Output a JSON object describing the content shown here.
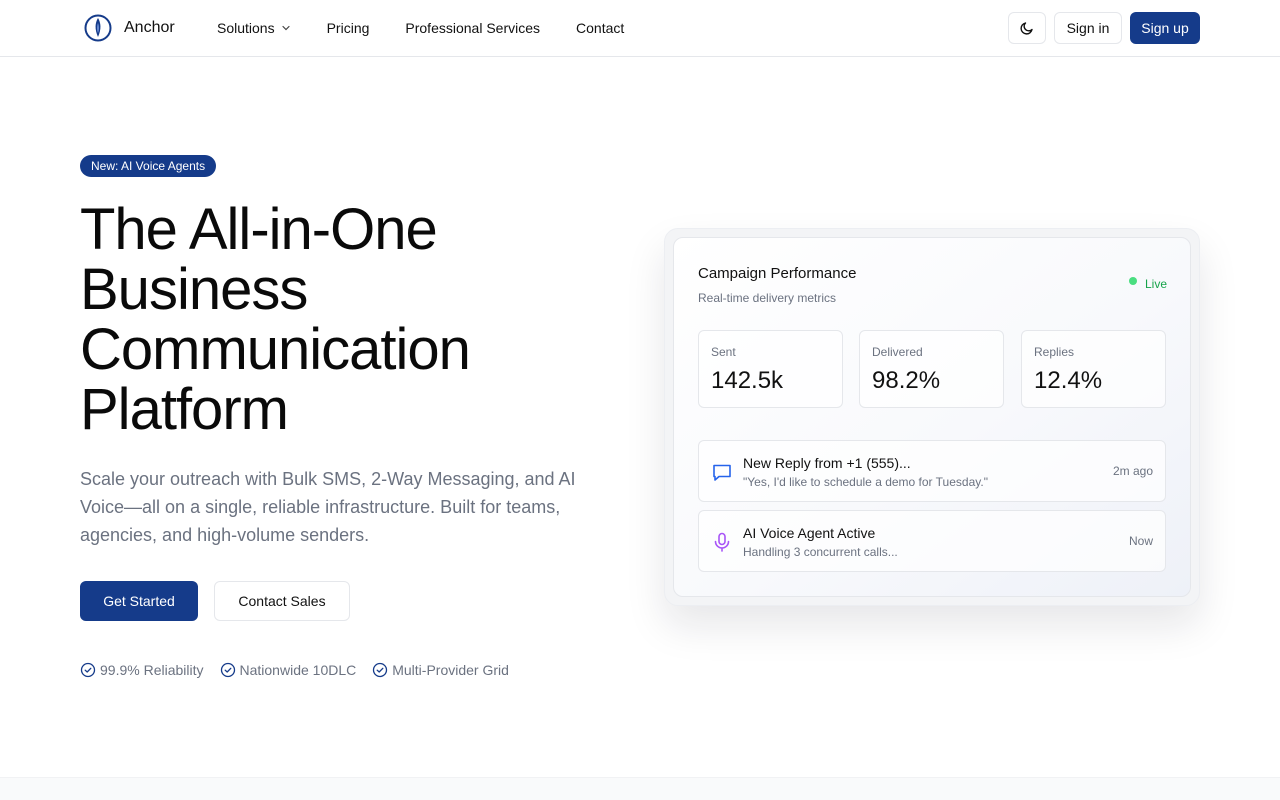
{
  "header": {
    "brand": "Anchor",
    "nav": [
      {
        "label": "Solutions",
        "has_dropdown": true,
        "icon": "chevron-down-icon"
      },
      {
        "label": "Pricing"
      },
      {
        "label": "Professional Services"
      },
      {
        "label": "Contact"
      }
    ],
    "theme_toggle_icon": "moon-icon",
    "sign_in_label": "Sign in",
    "sign_up_label": "Sign up"
  },
  "hero": {
    "badge": "New: AI Voice Agents",
    "title_lines": [
      "The All-in-One",
      "Business",
      "Communication",
      "Platform"
    ],
    "subtitle": "Scale your outreach with Bulk SMS, 2-Way Messaging, and AI Voice—all on a single, reliable infrastructure. Built for teams, agencies, and high-volume senders.",
    "primary_cta": "Get Started",
    "secondary_cta": "Contact Sales",
    "features": [
      "99.9% Reliability",
      "Nationwide 10DLC",
      "Multi-Provider Grid"
    ]
  },
  "card": {
    "title": "Campaign Performance",
    "subtitle": "Real-time delivery metrics",
    "status": "Live",
    "stats": [
      {
        "label": "Sent",
        "value": "142.5k"
      },
      {
        "label": "Delivered",
        "value": "98.2%"
      },
      {
        "label": "Replies",
        "value": "12.4%"
      }
    ],
    "activities": [
      {
        "icon": "message-icon",
        "title": "New Reply from +1 (555)...",
        "detail": "\"Yes, I'd like to schedule a demo for Tuesday.\"",
        "time": "2m ago"
      },
      {
        "icon": "microphone-icon",
        "title": "AI Voice Agent Active",
        "detail": "Handling 3 concurrent calls...",
        "time": "Now"
      }
    ]
  },
  "colors": {
    "brand": "#153b8a",
    "live_green": "#16a34a",
    "voice_purple": "#a855f7",
    "message_blue": "#2563eb"
  }
}
